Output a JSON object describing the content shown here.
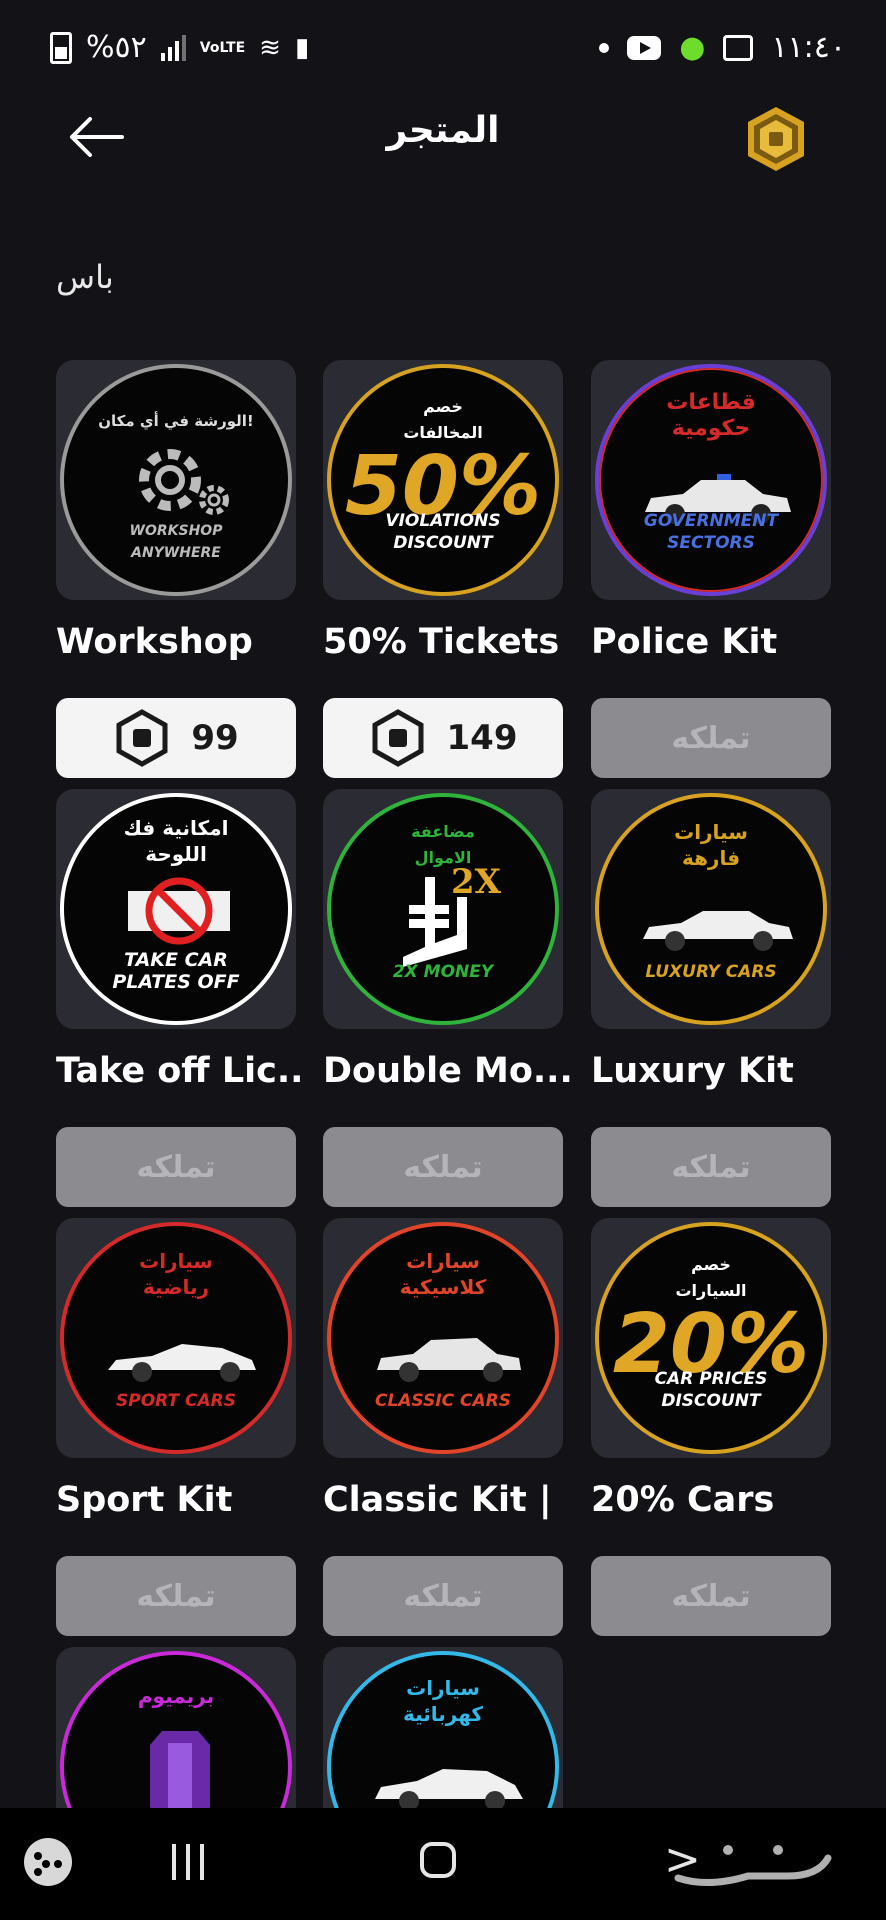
{
  "status_bar": {
    "battery": "%٥٢",
    "volte": "VoLTE",
    "time": "١١:٤٠"
  },
  "header": {
    "title": "المتجر",
    "back_icon": "arrow-left-icon",
    "currency_icon": "robux-coin-icon"
  },
  "section_title": "باس",
  "colors": {
    "background": "#131217",
    "tile": "#2b2b33",
    "price_button": "#f4f4f4",
    "owned_button": "#8c8b90",
    "gold": "#d6a21f"
  },
  "items": [
    {
      "name": "Workshop",
      "price": "99",
      "button": "",
      "ring": "#9a9a9a",
      "art_top": "الورشة في أي مكان!",
      "art_main": "",
      "art_bottom": "WORKSHOP ANYWHERE",
      "art_icon": "gear-icon"
    },
    {
      "name": "50% Tickets",
      "price": "149",
      "button": "",
      "ring": "#d6a21f",
      "art_top": "خصم المخالفات",
      "art_main": "50%",
      "art_bottom": "VIOLATIONS DISCOUNT",
      "art_icon": "percent-icon"
    },
    {
      "name": "Police Kit",
      "price": "",
      "button": "تملكه",
      "ring": "#6a3fd8",
      "art_top": "قطاعات حكومية",
      "art_main": "",
      "art_bottom": "GOVERNMENT SECTORS",
      "art_icon": "police-car-icon"
    },
    {
      "name": "Take off Lic...",
      "price": "",
      "button": "تملكه",
      "ring": "#ffffff",
      "art_top": "امكانية فك اللوحة",
      "art_main": "",
      "art_bottom": "TAKE CAR PLATES OFF",
      "art_icon": "no-plate-icon"
    },
    {
      "name": "Double Mo...",
      "price": "",
      "button": "تملكه",
      "ring": "#2fb33a",
      "art_top": "مضاعفة الاموال",
      "art_main": "2X",
      "art_bottom": "2X MONEY",
      "art_icon": "money-icon"
    },
    {
      "name": "Luxury Kit",
      "price": "",
      "button": "تملكه",
      "ring": "#d6a21f",
      "art_top": "سيارات فارهة",
      "art_main": "",
      "art_bottom": "LUXURY CARS",
      "art_icon": "sedan-icon"
    },
    {
      "name": "Sport Kit",
      "price": "",
      "button": "تملكه",
      "ring": "#d42a2a",
      "art_top": "سيارات رياضية",
      "art_main": "",
      "art_bottom": "SPORT CARS",
      "art_icon": "sport-car-icon"
    },
    {
      "name": "Classic Kit |",
      "price": "",
      "button": "تملكه",
      "ring": "#e0452a",
      "art_top": "سيارات كلاسيكية",
      "art_main": "",
      "art_bottom": "CLASSIC CARS",
      "art_icon": "classic-car-icon"
    },
    {
      "name": "20% Cars",
      "price": "",
      "button": "تملكه",
      "ring": "#d6a21f",
      "art_top": "خصم السيارات",
      "art_main": "20%",
      "art_bottom": "CAR PRICES DISCOUNT",
      "art_icon": "percent-icon"
    },
    {
      "name": "",
      "price": "",
      "button": "",
      "ring": "#c82ad8",
      "art_top": "بريميوم",
      "art_main": "",
      "art_bottom": "",
      "art_icon": "gem-icon"
    },
    {
      "name": "",
      "price": "",
      "button": "",
      "ring": "#34b8e8",
      "art_top": "سيارات كهربائية",
      "art_main": "",
      "art_bottom": "",
      "art_icon": "electric-car-icon"
    }
  ],
  "nav_bar": {
    "games": "game-launcher-icon",
    "recents": "recent-apps-icon",
    "home": "home-icon",
    "back": "back-icon",
    "watermark": "حراج"
  }
}
